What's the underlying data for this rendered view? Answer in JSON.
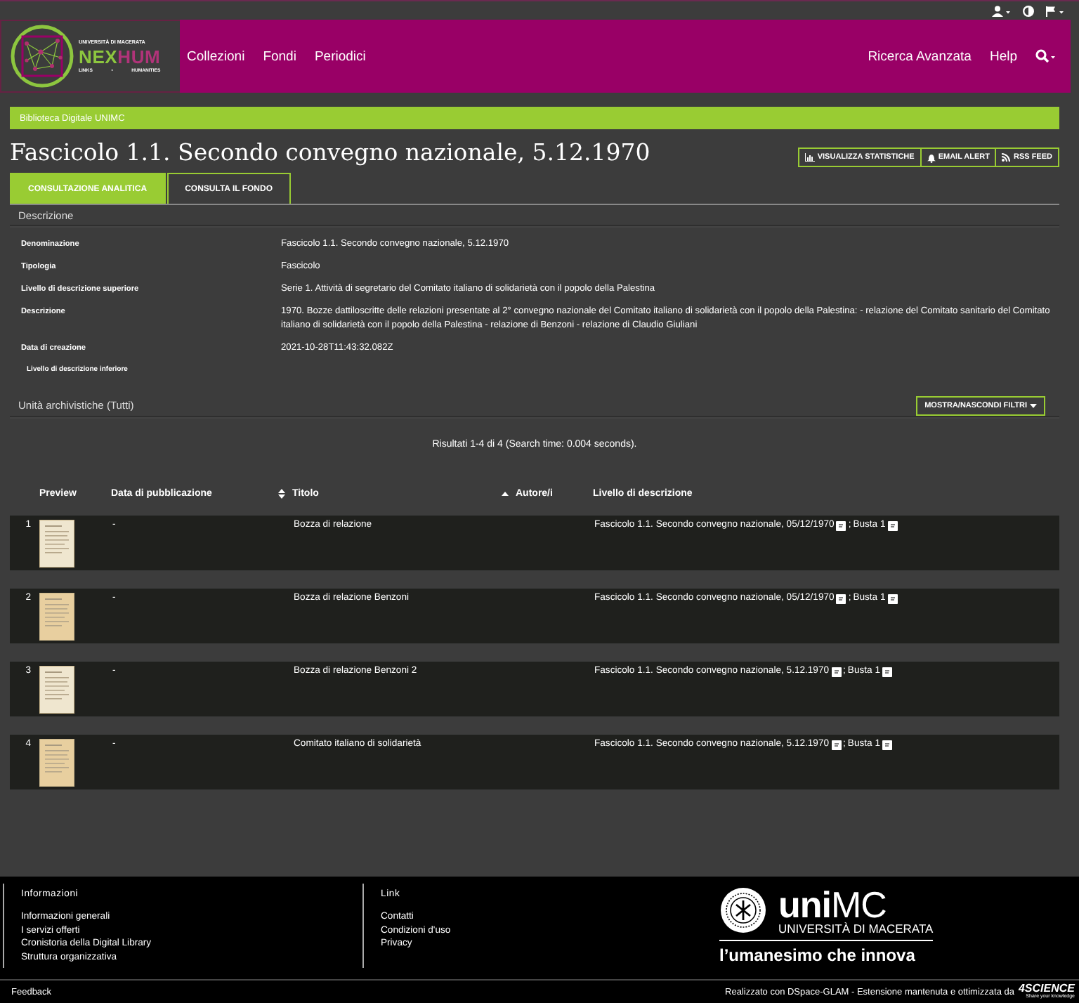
{
  "logo": {
    "university": "UNIVERSITÀ DI MACERATA",
    "name_a": "NEX",
    "name_b": "HUM",
    "left": "LINKS",
    "dot": "•",
    "right": "HUMANITIES"
  },
  "nav": {
    "items": [
      "Collezioni",
      "Fondi",
      "Periodici"
    ],
    "right_items": [
      "Ricerca Avanzata",
      "Help"
    ]
  },
  "breadcrumb": "Biblioteca Digitale UNIMC",
  "title": "Fascicolo 1.1. Secondo convegno nazionale, 5.12.1970",
  "actions": [
    {
      "kind": "chart",
      "label": "VISUALIZZA STATISTICHE"
    },
    {
      "kind": "bell",
      "label": "EMAIL ALERT"
    },
    {
      "kind": "rss",
      "label": "RSS FEED"
    }
  ],
  "tabs": [
    {
      "label": "CONSULTAZIONE ANALITICA",
      "selected": true
    },
    {
      "label": "CONSULTA IL FONDO",
      "selected": false
    }
  ],
  "description": {
    "heading": "Descrizione",
    "fields": [
      {
        "kind": "field",
        "label": "Denominazione",
        "value": "Fascicolo 1.1. Secondo convegno nazionale, 5.12.1970"
      },
      {
        "kind": "field",
        "label": "Tipologia",
        "value": "Fascicolo"
      },
      {
        "kind": "field",
        "label": "Livello di descrizione superiore",
        "value": "Serie 1. Attività di segretario del Comitato italiano di solidarietà con il popolo della Palestina"
      },
      {
        "kind": "field",
        "label": "Descrizione",
        "value": "1970. Bozze dattiloscritte delle relazioni presentate al 2° convegno nazionale del Comitato italiano di solidarietà con il popolo della Palestina: - relazione del Comitato sanitario del Comitato italiano di solidarietà con il popolo della Palestina - relazione di Benzoni - relazione di Claudio Giuliani"
      },
      {
        "kind": "field",
        "label": "Data di creazione",
        "value": "2021-10-28T11:43:32.082Z"
      },
      {
        "kind": "sub",
        "label": "Livello di descrizione inferiore"
      }
    ]
  },
  "units": {
    "heading": "Unità archivistiche (Tutti)",
    "filter_button": "MOSTRA/NASCONDI FILTRI",
    "results": "Risultati 1-4 di 4 (Search time: 0.004 seconds).",
    "columns": [
      {
        "label": "Preview",
        "kind": "plain"
      },
      {
        "label": "Data di pubblicazione",
        "kind": "sortable"
      },
      {
        "label": "Titolo",
        "kind": "sorted"
      },
      {
        "label": "Autore/i",
        "kind": "plain"
      },
      {
        "label": "Livello di descrizione",
        "kind": "plain"
      }
    ],
    "rows": [
      {
        "index": "1",
        "date": "-",
        "title": "Bozza di relazione",
        "levels": [
          "Fascicolo 1.1. Secondo convegno nazionale, 05/12/1970",
          "Busta 1"
        ],
        "separator": ";"
      },
      {
        "index": "2",
        "date": "-",
        "title": "Bozza di relazione Benzoni",
        "levels": [
          "Fascicolo 1.1. Secondo convegno nazionale, 05/12/1970",
          "Busta 1"
        ],
        "separator": ";"
      },
      {
        "index": "3",
        "date": "-",
        "title": "Bozza di relazione Benzoni 2",
        "levels": [
          "Fascicolo 1.1. Secondo convegno nazionale, 5.12.1970",
          "Busta 1"
        ],
        "separator": ";"
      },
      {
        "index": "4",
        "date": "-",
        "title": "Comitato italiano di solidarietà",
        "levels": [
          "Fascicolo 1.1. Secondo convegno nazionale, 5.12.1970",
          "Busta 1"
        ],
        "separator": ";"
      }
    ]
  },
  "footer": {
    "columns": [
      {
        "heading": "Informazioni",
        "links": [
          "Informazioni generali",
          "I servizi offerti",
          "Cronistoria della Digital Library",
          "Struttura organizzativa"
        ]
      },
      {
        "heading": "Link",
        "links": [
          "Contatti",
          "Condizioni d'uso",
          "Privacy"
        ]
      }
    ],
    "brand": {
      "name": "**uni**MC",
      "university": "UNIVERSITÀ DI MACERATA",
      "motto": "l’umanesimo che innova"
    },
    "feedback": "Feedback",
    "credits": "Realizzato con DSpace-GLAM - Estensione mantenuta e ottimizzata da",
    "partner": "4SCIENCE",
    "partner_tagline": "Share your knowledge"
  }
}
